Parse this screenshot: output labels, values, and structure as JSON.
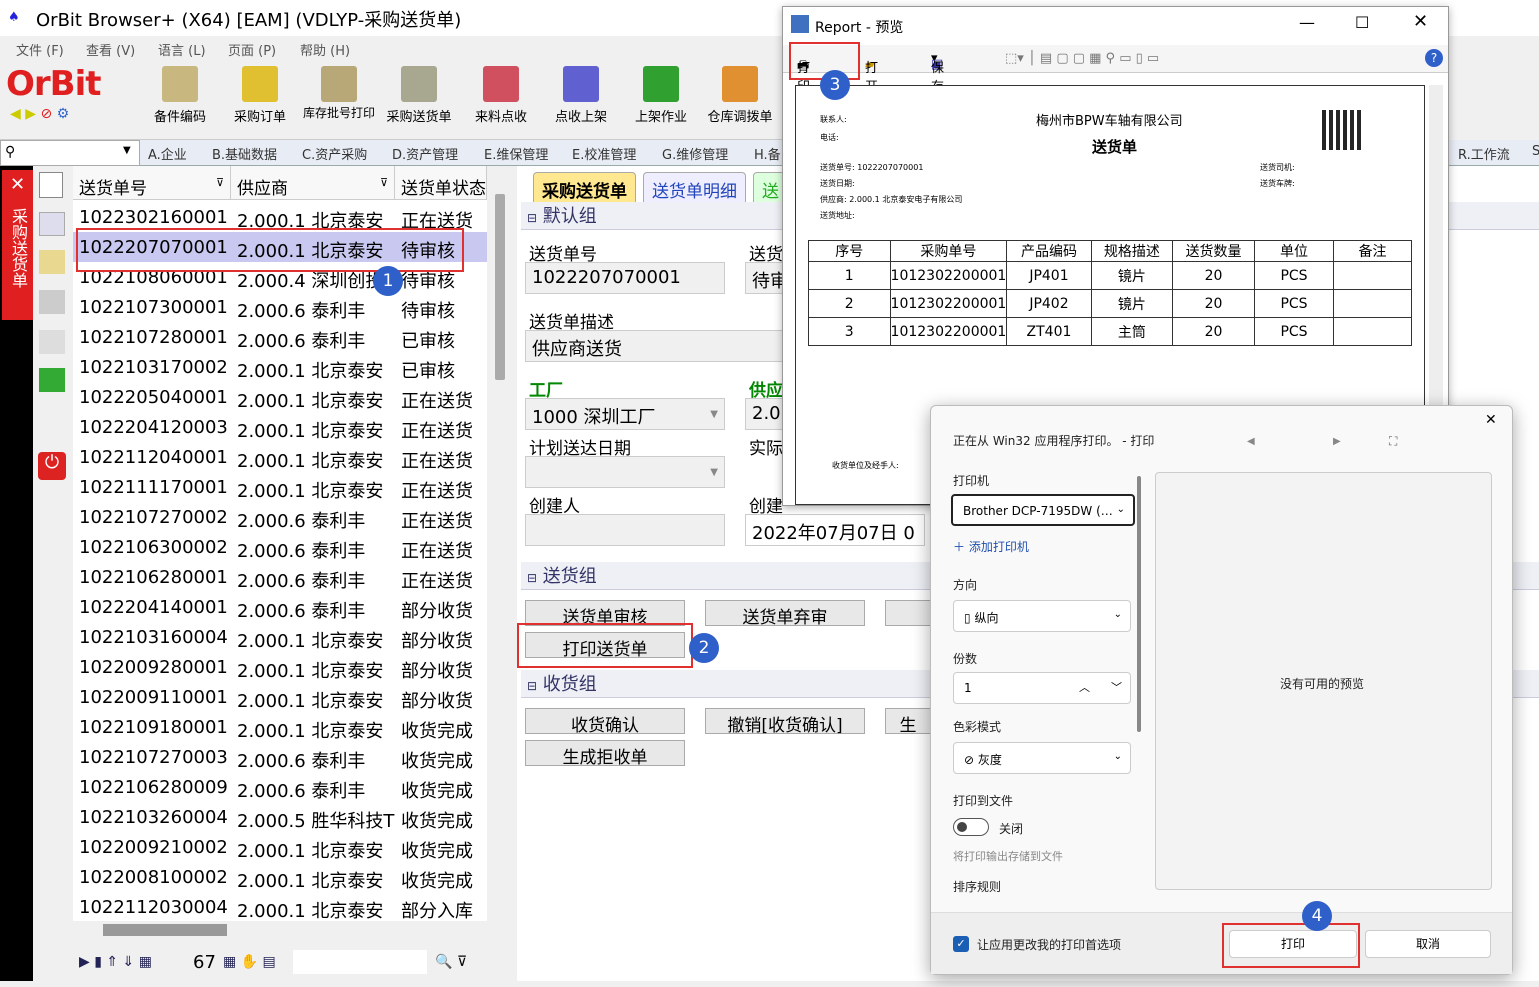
{
  "window": {
    "title": "OrBit Browser+ (X64) [EAM] (VDLYP-采购送货单)"
  },
  "menu": [
    "文件 (F)",
    "查看 (V)",
    "语言 (L)",
    "页面 (P)",
    "帮助 (H)"
  ],
  "logo": "OrBit",
  "toolbar": [
    "备件编码",
    "采购订单",
    "库存批号打印",
    "采购送货单",
    "来料点收",
    "点收上架",
    "上架作业",
    "仓库调拨单"
  ],
  "module_tabs": [
    "A.企业",
    "B.基础数据",
    "C.资产采购",
    "D.资产管理",
    "E.维保管理",
    "E.校准管理",
    "G.维修管理",
    "H.备",
    "R.工作流",
    "S"
  ],
  "side_tab": "采购送货单",
  "list": {
    "headers": [
      "送货单号",
      "供应商",
      "送货单状态"
    ],
    "rows": [
      [
        "1022302160001",
        "2.000.1 北京泰安",
        "正在送货"
      ],
      [
        "1022207070001",
        "2.000.1 北京泰安",
        "待审核"
      ],
      [
        "1022108060001",
        "2.000.4 深圳创投",
        "待审核"
      ],
      [
        "1022107300001",
        "2.000.6 泰利丰",
        "待审核"
      ],
      [
        "1022107280001",
        "2.000.6 泰利丰",
        "已审核"
      ],
      [
        "1022103170002",
        "2.000.1 北京泰安",
        "已审核"
      ],
      [
        "1022205040001",
        "2.000.1 北京泰安",
        "正在送货"
      ],
      [
        "1022204120003",
        "2.000.1 北京泰安",
        "正在送货"
      ],
      [
        "1022112040001",
        "2.000.1 北京泰安",
        "正在送货"
      ],
      [
        "1022111170001",
        "2.000.1 北京泰安",
        "正在送货"
      ],
      [
        "1022107270002",
        "2.000.6 泰利丰",
        "正在送货"
      ],
      [
        "1022106300002",
        "2.000.6 泰利丰",
        "正在送货"
      ],
      [
        "1022106280001",
        "2.000.6 泰利丰",
        "正在送货"
      ],
      [
        "1022204140001",
        "2.000.6 泰利丰",
        "部分收货"
      ],
      [
        "1022103160004",
        "2.000.1 北京泰安",
        "部分收货"
      ],
      [
        "1022009280001",
        "2.000.1 北京泰安",
        "部分收货"
      ],
      [
        "1022009110001",
        "2.000.1 北京泰安",
        "部分收货"
      ],
      [
        "1022109180001",
        "2.000.1 北京泰安",
        "收货完成"
      ],
      [
        "1022107270003",
        "2.000.6 泰利丰",
        "收货完成"
      ],
      [
        "1022106280009",
        "2.000.6 泰利丰",
        "收货完成"
      ],
      [
        "1022103260004",
        "2.000.5 胜华科技T",
        "收货完成"
      ],
      [
        "1022009210002",
        "2.000.1 北京泰安",
        "收货完成"
      ],
      [
        "1022008100002",
        "2.000.1 北京泰安",
        "收货完成"
      ],
      [
        "1022112030004",
        "2.000.1 北京泰安",
        "部分入库"
      ]
    ],
    "count": "67"
  },
  "detail": {
    "tabs": [
      "采购送货单",
      "送货单明细",
      "送"
    ],
    "group_default": "默认组",
    "f_no_label": "送货单号",
    "f_no": "1022207070001",
    "f_status_label": "送货",
    "f_status": "待审",
    "f_desc_label": "送货单描述",
    "f_desc": "供应商送货",
    "f_plant_label": "工厂",
    "f_plant": "1000 深圳工厂",
    "f_supp_label": "供应",
    "f_supp": "2.0",
    "f_plan_label": "计划送达日期",
    "f_actual_label": "实际",
    "f_creator_label": "创建人",
    "f_created_label": "创建",
    "f_created": "2022年07月07日 0",
    "group_ship": "送货组",
    "btn_audit": "送货单审核",
    "btn_abandon": "送货单弃审",
    "btn_print": "打印送货单",
    "group_recv": "收货组",
    "btn_recv": "收货确认",
    "btn_cancel_recv": "撤销[收货确认]",
    "btn_reject": "生成拒收单",
    "btn_gen": "生"
  },
  "report": {
    "title": "Report - 预览",
    "tools": [
      "打印",
      "打开",
      "保存"
    ],
    "company": "梅州市BPW车轴有限公司",
    "doc_title": "送货单",
    "contact": "联系人:",
    "phone": "电话:",
    "no_line": "送货单号: 1022207070001",
    "date": "送货日期:",
    "supplier": "供应商:  2.000.1 北京泰安电子有限公司",
    "addr": "送货地址:",
    "driver": "送货司机:",
    "car": "送货车牌:",
    "cols": [
      "序号",
      "采购单号",
      "产品编码",
      "规格描述",
      "送货数量",
      "单位",
      "备注"
    ],
    "rows": [
      [
        "1",
        "1012302200001",
        "JP401",
        "镜片",
        "20",
        "PCS",
        ""
      ],
      [
        "2",
        "1012302200001",
        "JP402",
        "镜片",
        "20",
        "PCS",
        ""
      ],
      [
        "3",
        "1012302200001",
        "ZT401",
        "主筒",
        "20",
        "PCS",
        ""
      ]
    ],
    "sign": "收货单位及经手人:"
  },
  "print": {
    "header": "正在从 Win32 应用程序打印。 - 打印",
    "printer_label": "打印机",
    "printer": "Brother DCP-7195DW (…",
    "add_printer": "添加打印机",
    "orient_label": "方向",
    "orient": "纵向",
    "copies_label": "份数",
    "copies": "1",
    "color_label": "色彩模式",
    "color": "灰度",
    "tofile_label": "打印到文件",
    "tofile": "关闭",
    "tofile_hint": "将打印输出存储到文件",
    "collate": "排序规则",
    "no_preview": "没有可用的预览",
    "allow": "让应用更改我的打印首选项",
    "ok": "打印",
    "cancel": "取消"
  },
  "badges": [
    "1",
    "2",
    "3",
    "4"
  ],
  "colors": {
    "accent": "#e02020",
    "selected_row": "#c8c8f0",
    "badge": "#2f5fc8",
    "highlight_box": "#e03030"
  }
}
